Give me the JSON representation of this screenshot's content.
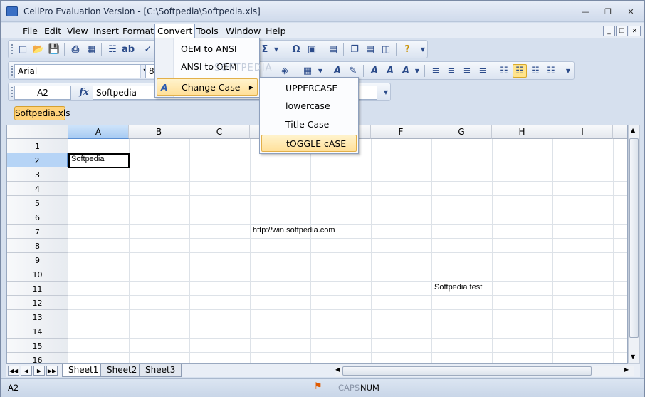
{
  "window": {
    "title": "CellPro Evaluation Version - [C:\\Softpedia\\Softpedia.xls]"
  },
  "menubar": {
    "items": [
      "File",
      "Edit",
      "View",
      "Insert",
      "Format",
      "Convert",
      "Tools",
      "Window",
      "Help"
    ],
    "active": "Convert"
  },
  "format_toolbar": {
    "font": "Arial",
    "size": "8"
  },
  "formula_bar": {
    "cell_ref": "A2",
    "fx": "fx",
    "content": "Softpedia"
  },
  "file_tab": "Softpedia.xls",
  "grid": {
    "columns": [
      "A",
      "B",
      "C",
      "D",
      "E",
      "F",
      "G",
      "H",
      "I"
    ],
    "rows": [
      "1",
      "2",
      "3",
      "4",
      "5",
      "6",
      "7",
      "8",
      "9",
      "10",
      "11",
      "12",
      "13",
      "14",
      "15",
      "16"
    ],
    "cells": {
      "A2": "Softpedia",
      "D7": "http://win.softpedia.com",
      "G11": "Softpedia test"
    },
    "selected": "A2"
  },
  "sheets": [
    "Sheet1",
    "Sheet2",
    "Sheet3"
  ],
  "active_sheet": "Sheet1",
  "status": {
    "cell": "A2",
    "caps": "CAPS",
    "num": "NUM"
  },
  "convert_menu": {
    "items": [
      "OEM to ANSI",
      "ANSI to OEM",
      "Change Case"
    ],
    "highlighted": "Change Case"
  },
  "change_case_menu": {
    "items": [
      "UPPERCASE",
      "lowercase",
      "Title Case",
      "tOGGLE cASE"
    ],
    "highlighted": "tOGGLE cASE"
  },
  "watermark": "SOFTPEDIA",
  "colors": {
    "accent": "#ffe09a",
    "selection": "#b6d4f6",
    "frame": "#d6e0ee"
  }
}
